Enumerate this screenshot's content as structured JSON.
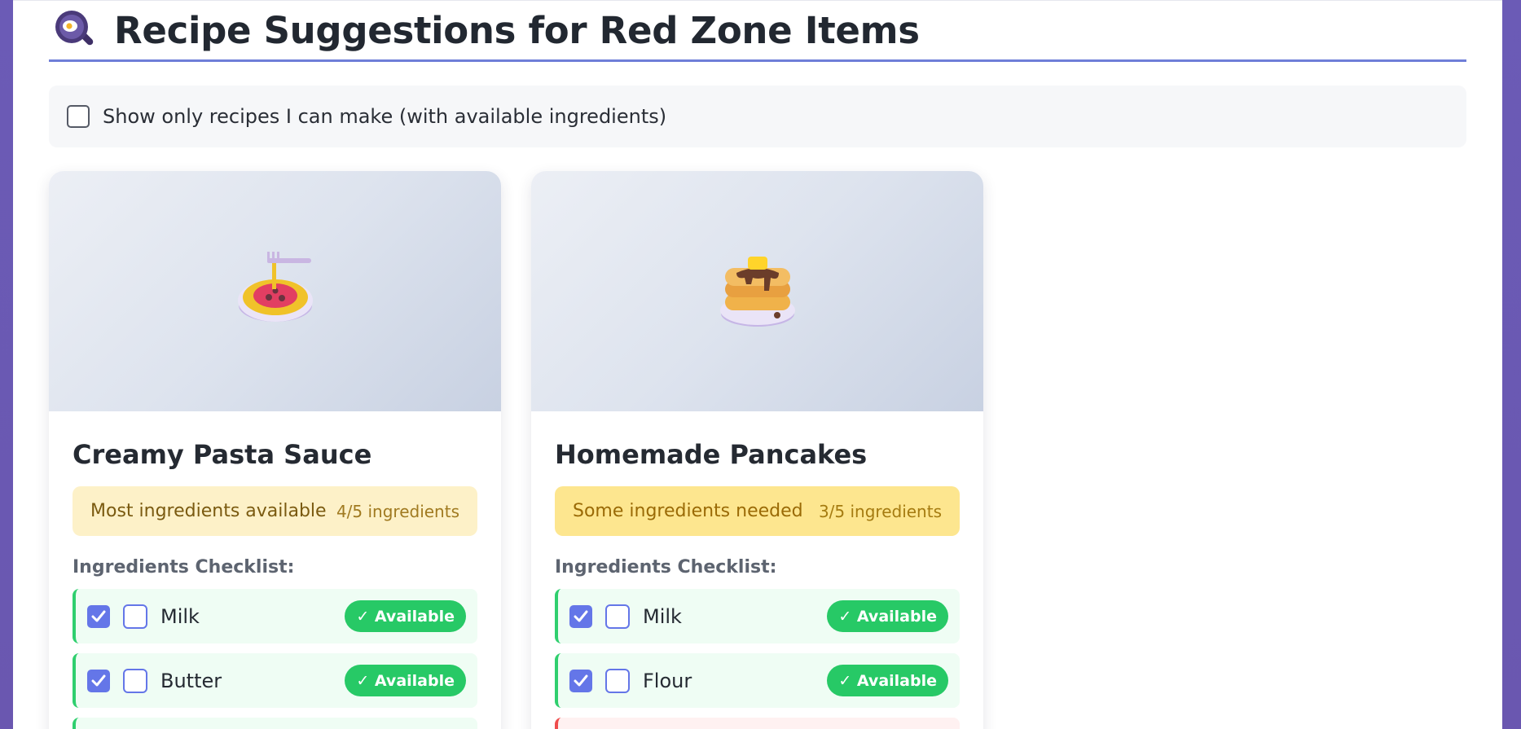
{
  "header": {
    "title": "Recipe Suggestions for Red Zone Items",
    "icon": "frying-pan-egg-icon"
  },
  "filter": {
    "label": "Show only recipes I can make (with available ingredients)",
    "checked": false
  },
  "section_label": "Ingredients Checklist:",
  "recipes": [
    {
      "title": "Creamy Pasta Sauce",
      "image_icon": "spaghetti-icon",
      "status": "Most ingredients available",
      "count": "4/5 ingredients",
      "status_bg": "#fdf1c8",
      "status_color": "#7a5a10",
      "count_color": "#a07a20",
      "ingredients": [
        {
          "name": "Milk",
          "badge": "✓ Available"
        },
        {
          "name": "Butter",
          "badge": "✓ Available"
        }
      ],
      "next_row_bg": "#effdf4",
      "next_row_border": "#2fcf6e"
    },
    {
      "title": "Homemade Pancakes",
      "image_icon": "pancakes-icon",
      "status": "Some ingredients needed",
      "count": "3/5 ingredients",
      "status_bg": "#fde68f",
      "status_color": "#9a6a06",
      "count_color": "#a57b10",
      "ingredients": [
        {
          "name": "Milk",
          "badge": "✓ Available"
        },
        {
          "name": "Flour",
          "badge": "✓ Available"
        }
      ],
      "next_row_bg": "#fff1f1",
      "next_row_border": "#ef4d4d"
    }
  ]
}
